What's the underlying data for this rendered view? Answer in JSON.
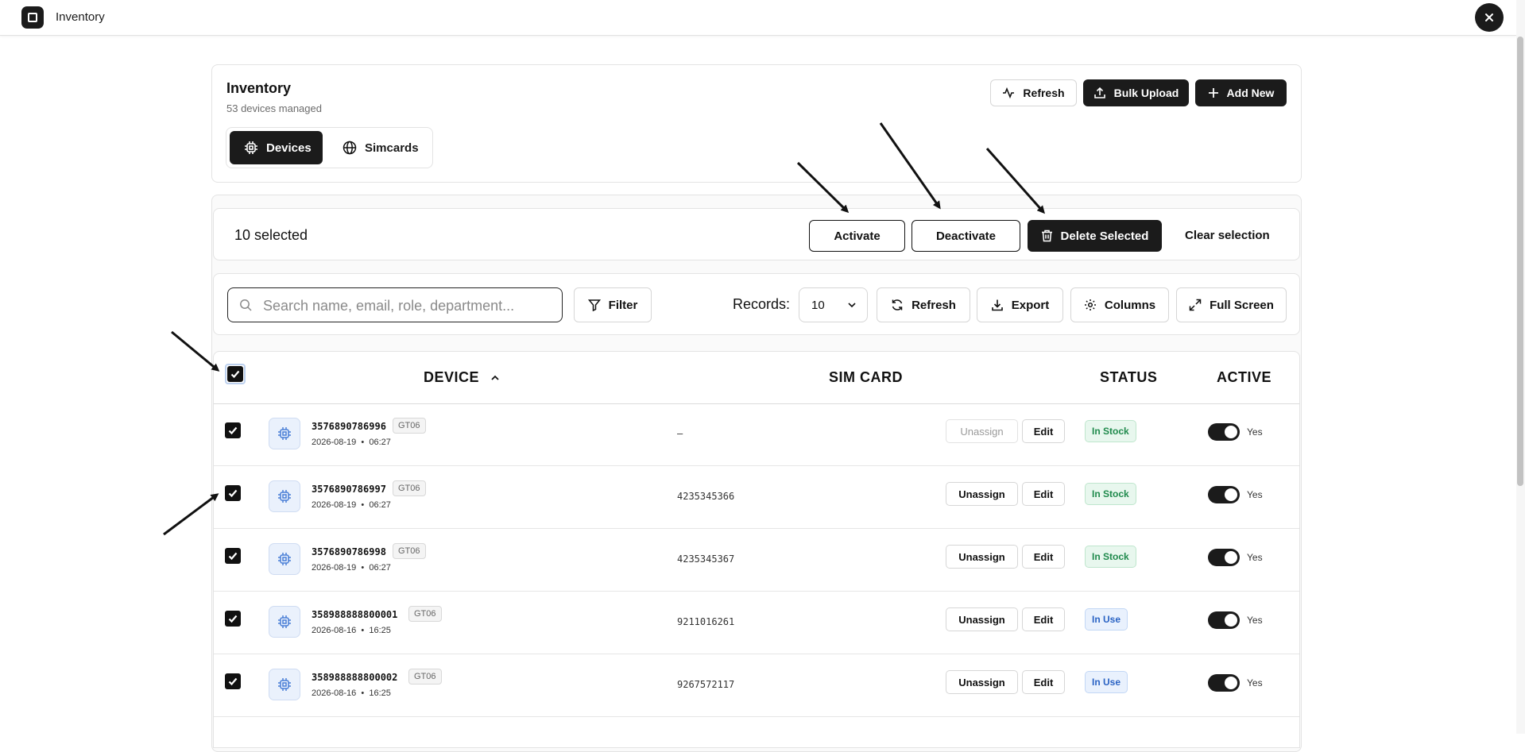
{
  "app": {
    "title": "Inventory",
    "close_icon": "close-icon"
  },
  "header": {
    "title": "Inventory",
    "subtitle": "53 devices managed",
    "tabs": [
      {
        "label": "Devices",
        "icon": "chip-icon"
      },
      {
        "label": "Simcards",
        "icon": "globe-icon"
      }
    ],
    "actions": {
      "refresh": "Refresh",
      "bulk_upload": "Bulk Upload",
      "add_new": "Add New"
    }
  },
  "selection_bar": {
    "count": "10 selected",
    "activate": "Activate",
    "deactivate": "Deactivate",
    "delete": "Delete Selected",
    "clear": "Clear selection"
  },
  "toolbar": {
    "search_placeholder": "Search name, email, role, department...",
    "filter": "Filter",
    "records_label": "Records:",
    "records_value": "10",
    "refresh": "Refresh",
    "export": "Export",
    "columns": "Columns",
    "full_screen": "Full Screen"
  },
  "table": {
    "columns": {
      "device": "DEVICE",
      "sim_card": "SIM CARD",
      "status": "STATUS",
      "active": "ACTIVE"
    },
    "rows": [
      {
        "device_id": "3576890786996",
        "model": "GT06",
        "date": "2026-08-19",
        "time": "06:27",
        "sim": "—",
        "unassign": "Unassign",
        "edit": "Edit",
        "status": "In Stock",
        "active": "Yes"
      },
      {
        "device_id": "3576890786997",
        "model": "GT06",
        "date": "2026-08-19",
        "time": "06:27",
        "sim": "4235345366",
        "unassign": "Unassign",
        "edit": "Edit",
        "status": "In Stock",
        "active": "Yes"
      },
      {
        "device_id": "3576890786998",
        "model": "GT06",
        "date": "2026-08-19",
        "time": "06:27",
        "sim": "4235345367",
        "unassign": "Unassign",
        "edit": "Edit",
        "status": "In Stock",
        "active": "Yes"
      },
      {
        "device_id": "358988888800001",
        "model": "GT06",
        "date": "2026-08-16",
        "time": "16:25",
        "sim": "9211016261",
        "unassign": "Unassign",
        "edit": "Edit",
        "status": "In Use",
        "active": "Yes"
      },
      {
        "device_id": "358988888800002",
        "model": "GT06",
        "date": "2026-08-16",
        "time": "16:25",
        "sim": "9267572117",
        "unassign": "Unassign",
        "edit": "Edit",
        "status": "In Use",
        "active": "Yes"
      }
    ]
  },
  "colors": {
    "dark": "#1b1b1b",
    "status_green": "#1f8a4c",
    "status_blue": "#2a63c4",
    "device_icon": "#4a7fd6"
  }
}
